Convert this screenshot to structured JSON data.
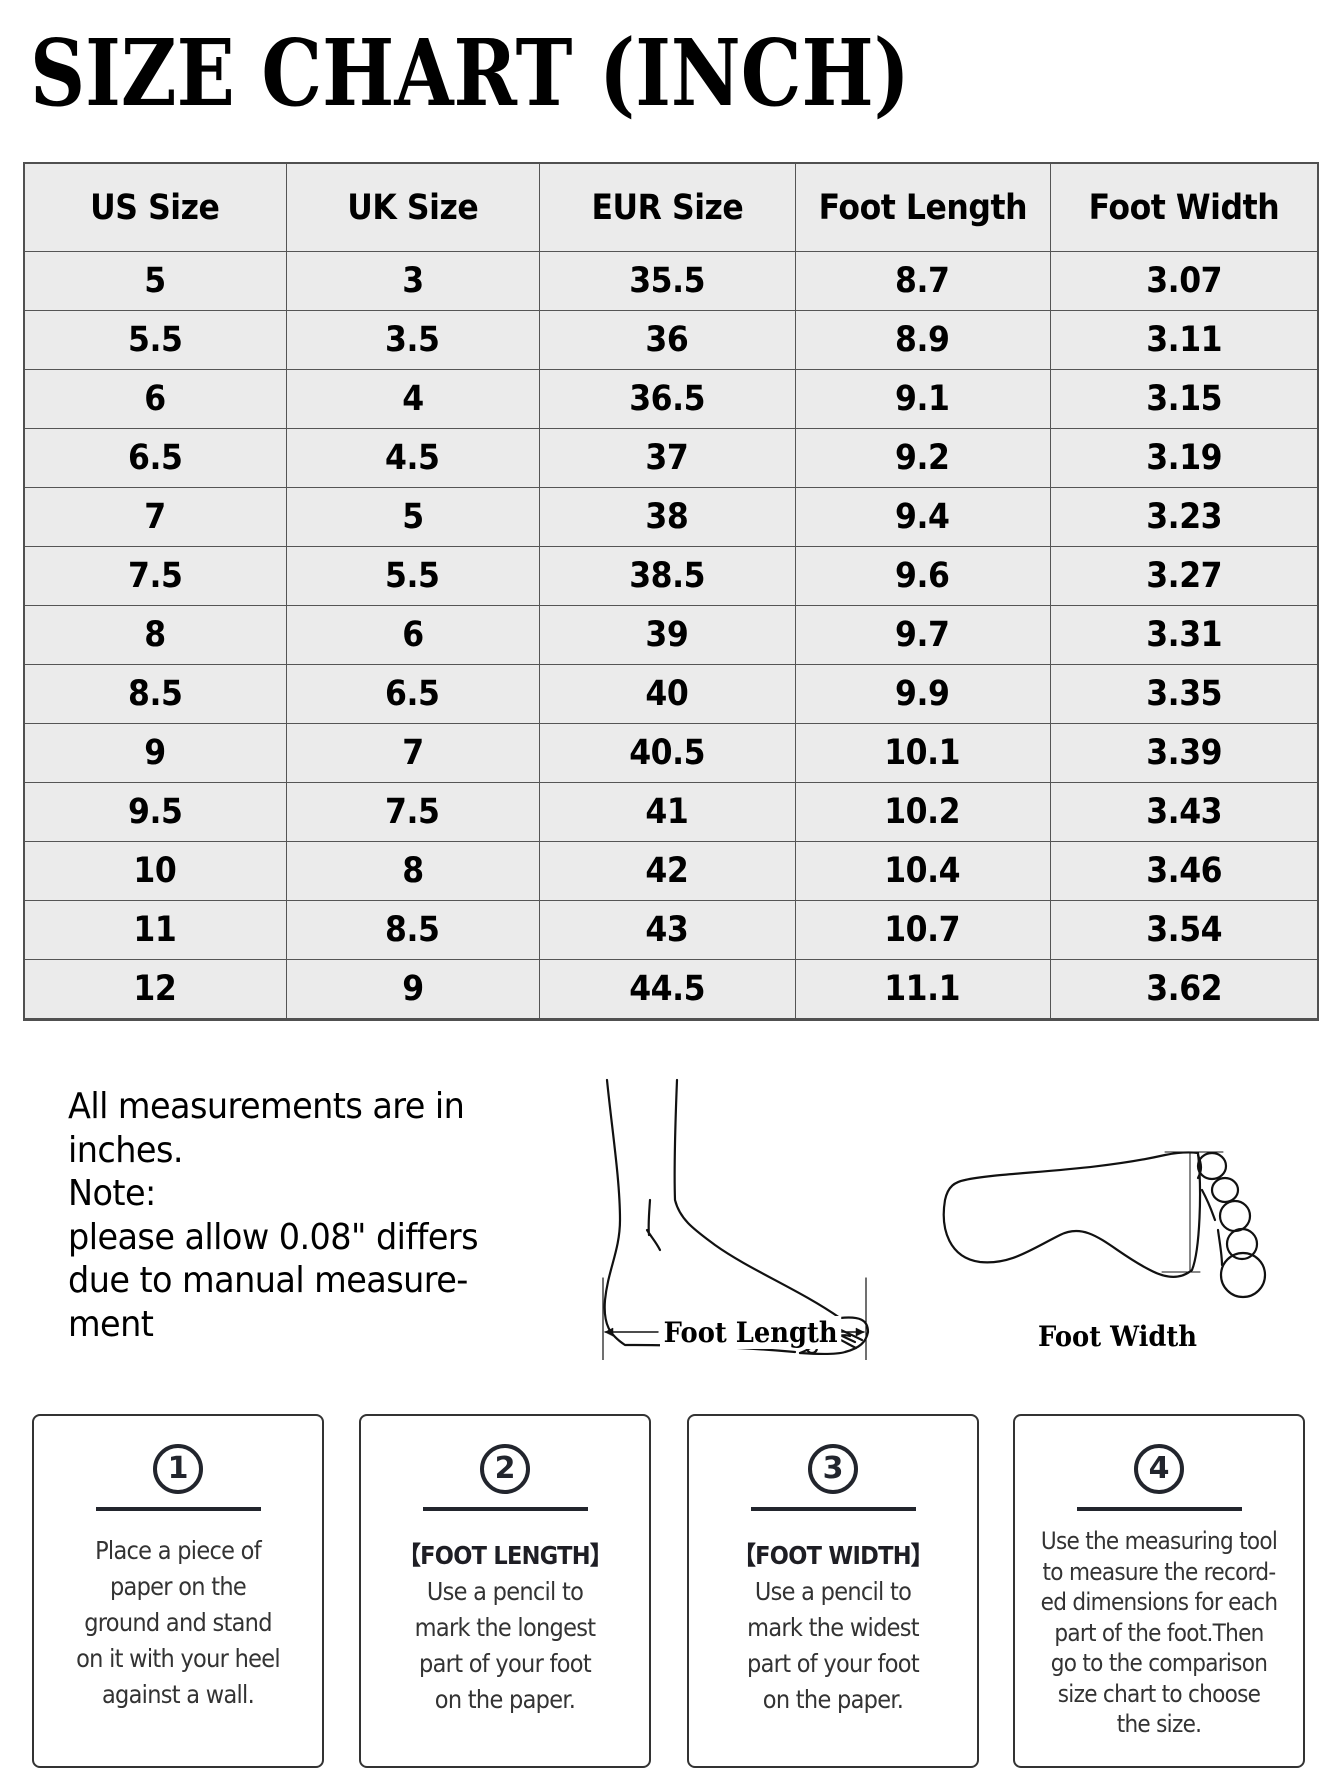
{
  "title": "SIZE CHART (INCH)",
  "chart_data": {
    "type": "table",
    "title": "SIZE CHART (INCH)",
    "columns": [
      "US Size",
      "UK Size",
      "EUR Size",
      "Foot Length",
      "Foot Width"
    ],
    "rows": [
      [
        "5",
        "3",
        "35.5",
        "8.7",
        "3.07"
      ],
      [
        "5.5",
        "3.5",
        "36",
        "8.9",
        "3.11"
      ],
      [
        "6",
        "4",
        "36.5",
        "9.1",
        "3.15"
      ],
      [
        "6.5",
        "4.5",
        "37",
        "9.2",
        "3.19"
      ],
      [
        "7",
        "5",
        "38",
        "9.4",
        "3.23"
      ],
      [
        "7.5",
        "5.5",
        "38.5",
        "9.6",
        "3.27"
      ],
      [
        "8",
        "6",
        "39",
        "9.7",
        "3.31"
      ],
      [
        "8.5",
        "6.5",
        "40",
        "9.9",
        "3.35"
      ],
      [
        "9",
        "7",
        "40.5",
        "10.1",
        "3.39"
      ],
      [
        "9.5",
        "7.5",
        "41",
        "10.2",
        "3.43"
      ],
      [
        "10",
        "8",
        "42",
        "10.4",
        "3.46"
      ],
      [
        "11",
        "8.5",
        "43",
        "10.7",
        "3.54"
      ],
      [
        "12",
        "9",
        "44.5",
        "11.1",
        "3.62"
      ]
    ]
  },
  "note": {
    "lines": [
      "All measurements are in",
      "inches.",
      "Note:",
      "please allow 0.08\" differs",
      "due to manual measure-",
      "ment"
    ]
  },
  "figures": {
    "foot_length_label": "Foot Length",
    "foot_width_label": "Foot Width",
    "foot_length_icon": "foot-side-view-icon",
    "foot_width_icon": "foot-sole-view-icon"
  },
  "steps": [
    {
      "number": "1",
      "heading": "",
      "lines": [
        "Place a piece of",
        "paper on the",
        "ground and stand",
        "on it with your heel",
        "against a wall."
      ]
    },
    {
      "number": "2",
      "heading": "【FOOT LENGTH】",
      "lines": [
        "Use a pencil to",
        "mark the longest",
        "part of your foot",
        "on the paper."
      ]
    },
    {
      "number": "3",
      "heading": "【FOOT WIDTH】",
      "lines": [
        "Use a pencil to",
        "mark the widest",
        "part of your foot",
        "on the paper."
      ]
    },
    {
      "number": "4",
      "heading": "",
      "lines": [
        "Use the measuring tool",
        "to measure the record-",
        "ed dimensions for each",
        "part of the foot.Then",
        "go to the comparison",
        "size chart to choose",
        "the size."
      ]
    }
  ],
  "colors": {
    "table_bg": "#ebebeb",
    "table_border": "#555555",
    "card_text": "#333333",
    "accent_dark": "#22252d"
  }
}
